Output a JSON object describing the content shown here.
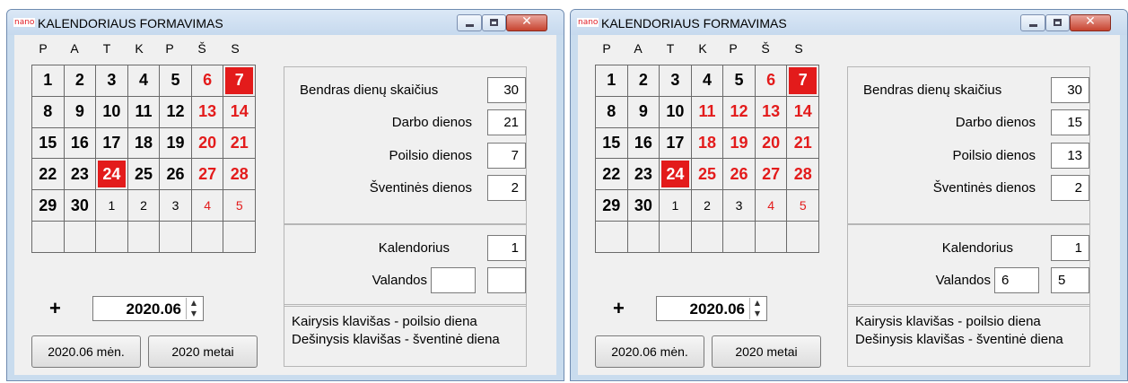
{
  "day_headers": [
    "P",
    "A",
    "T",
    "K",
    "P",
    "Š",
    "S"
  ],
  "windows": [
    {
      "app_logo": "nano",
      "title": "KALENDORIAUS FORMAVIMAS",
      "days": [
        [
          {
            "t": "1"
          },
          {
            "t": "2"
          },
          {
            "t": "3"
          },
          {
            "t": "4"
          },
          {
            "t": "5"
          },
          {
            "t": "6",
            "s": "red"
          },
          {
            "t": "7",
            "s": "redbg"
          }
        ],
        [
          {
            "t": "8"
          },
          {
            "t": "9"
          },
          {
            "t": "10"
          },
          {
            "t": "11"
          },
          {
            "t": "12"
          },
          {
            "t": "13",
            "s": "red"
          },
          {
            "t": "14",
            "s": "red"
          }
        ],
        [
          {
            "t": "15"
          },
          {
            "t": "16"
          },
          {
            "t": "17"
          },
          {
            "t": "18"
          },
          {
            "t": "19"
          },
          {
            "t": "20",
            "s": "red"
          },
          {
            "t": "21",
            "s": "red"
          }
        ],
        [
          {
            "t": "22"
          },
          {
            "t": "23"
          },
          {
            "t": "24",
            "s": "redbg"
          },
          {
            "t": "25"
          },
          {
            "t": "26"
          },
          {
            "t": "27",
            "s": "red"
          },
          {
            "t": "28",
            "s": "red"
          }
        ],
        [
          {
            "t": "29"
          },
          {
            "t": "30"
          },
          {
            "t": "1",
            "s": "other"
          },
          {
            "t": "2",
            "s": "other"
          },
          {
            "t": "3",
            "s": "other"
          },
          {
            "t": "4",
            "s": "other red"
          },
          {
            "t": "5",
            "s": "other red"
          }
        ],
        [
          {
            "t": ""
          },
          {
            "t": ""
          },
          {
            "t": ""
          },
          {
            "t": ""
          },
          {
            "t": ""
          },
          {
            "t": ""
          },
          {
            "t": ""
          }
        ]
      ],
      "period_value": "2020.06",
      "month_button": "2020.06 mėn.",
      "year_button": "2020 metai",
      "stats": {
        "total_label": "Bendras dienų skaičius",
        "total_value": "30",
        "work_label": "Darbo dienos",
        "work_value": "21",
        "rest_label": "Poilsio dienos",
        "rest_value": "7",
        "holiday_label": "Šventinės dienos",
        "holiday_value": "2"
      },
      "calendar_label": "Kalendorius",
      "calendar_value": "1",
      "hours_label": "Valandos",
      "hours_value_1": "",
      "hours_value_2": "",
      "hint_left": "Kairysis klavišas - poilsio diena",
      "hint_right": "Dešinysis klavišas - šventinė diena"
    },
    {
      "app_logo": "nano",
      "title": "KALENDORIAUS FORMAVIMAS",
      "days": [
        [
          {
            "t": "1"
          },
          {
            "t": "2"
          },
          {
            "t": "3"
          },
          {
            "t": "4"
          },
          {
            "t": "5"
          },
          {
            "t": "6",
            "s": "red"
          },
          {
            "t": "7",
            "s": "redbg"
          }
        ],
        [
          {
            "t": "8"
          },
          {
            "t": "9"
          },
          {
            "t": "10"
          },
          {
            "t": "11",
            "s": "red"
          },
          {
            "t": "12",
            "s": "red"
          },
          {
            "t": "13",
            "s": "red"
          },
          {
            "t": "14",
            "s": "red"
          }
        ],
        [
          {
            "t": "15"
          },
          {
            "t": "16"
          },
          {
            "t": "17"
          },
          {
            "t": "18",
            "s": "red"
          },
          {
            "t": "19",
            "s": "red"
          },
          {
            "t": "20",
            "s": "red"
          },
          {
            "t": "21",
            "s": "red"
          }
        ],
        [
          {
            "t": "22"
          },
          {
            "t": "23"
          },
          {
            "t": "24",
            "s": "redbg"
          },
          {
            "t": "25",
            "s": "red"
          },
          {
            "t": "26",
            "s": "red"
          },
          {
            "t": "27",
            "s": "red"
          },
          {
            "t": "28",
            "s": "red"
          }
        ],
        [
          {
            "t": "29"
          },
          {
            "t": "30"
          },
          {
            "t": "1",
            "s": "other"
          },
          {
            "t": "2",
            "s": "other"
          },
          {
            "t": "3",
            "s": "other"
          },
          {
            "t": "4",
            "s": "other red"
          },
          {
            "t": "5",
            "s": "other red"
          }
        ],
        [
          {
            "t": ""
          },
          {
            "t": ""
          },
          {
            "t": ""
          },
          {
            "t": ""
          },
          {
            "t": ""
          },
          {
            "t": ""
          },
          {
            "t": ""
          }
        ]
      ],
      "period_value": "2020.06",
      "month_button": "2020.06 mėn.",
      "year_button": "2020 metai",
      "stats": {
        "total_label": "Bendras dienų skaičius",
        "total_value": "30",
        "work_label": "Darbo dienos",
        "work_value": "15",
        "rest_label": "Poilsio dienos",
        "rest_value": "13",
        "holiday_label": "Šventinės dienos",
        "holiday_value": "2"
      },
      "calendar_label": "Kalendorius",
      "calendar_value": "1",
      "hours_label": "Valandos",
      "hours_value_1": "6",
      "hours_value_2": "5",
      "hint_left": "Kairysis klavišas - poilsio diena",
      "hint_right": "Dešinysis klavišas - šventinė diena"
    }
  ],
  "colors": {
    "holiday_red": "#e31b1b",
    "titlebar": "#c9dcee",
    "close_button": "#c7432f",
    "client_bg": "#f0f0f0"
  },
  "icons": {
    "minimize": "minimize-icon",
    "maximize": "maximize-icon",
    "close": "close-icon",
    "spin_up": "spin-up-icon",
    "spin_down": "spin-down-icon"
  }
}
